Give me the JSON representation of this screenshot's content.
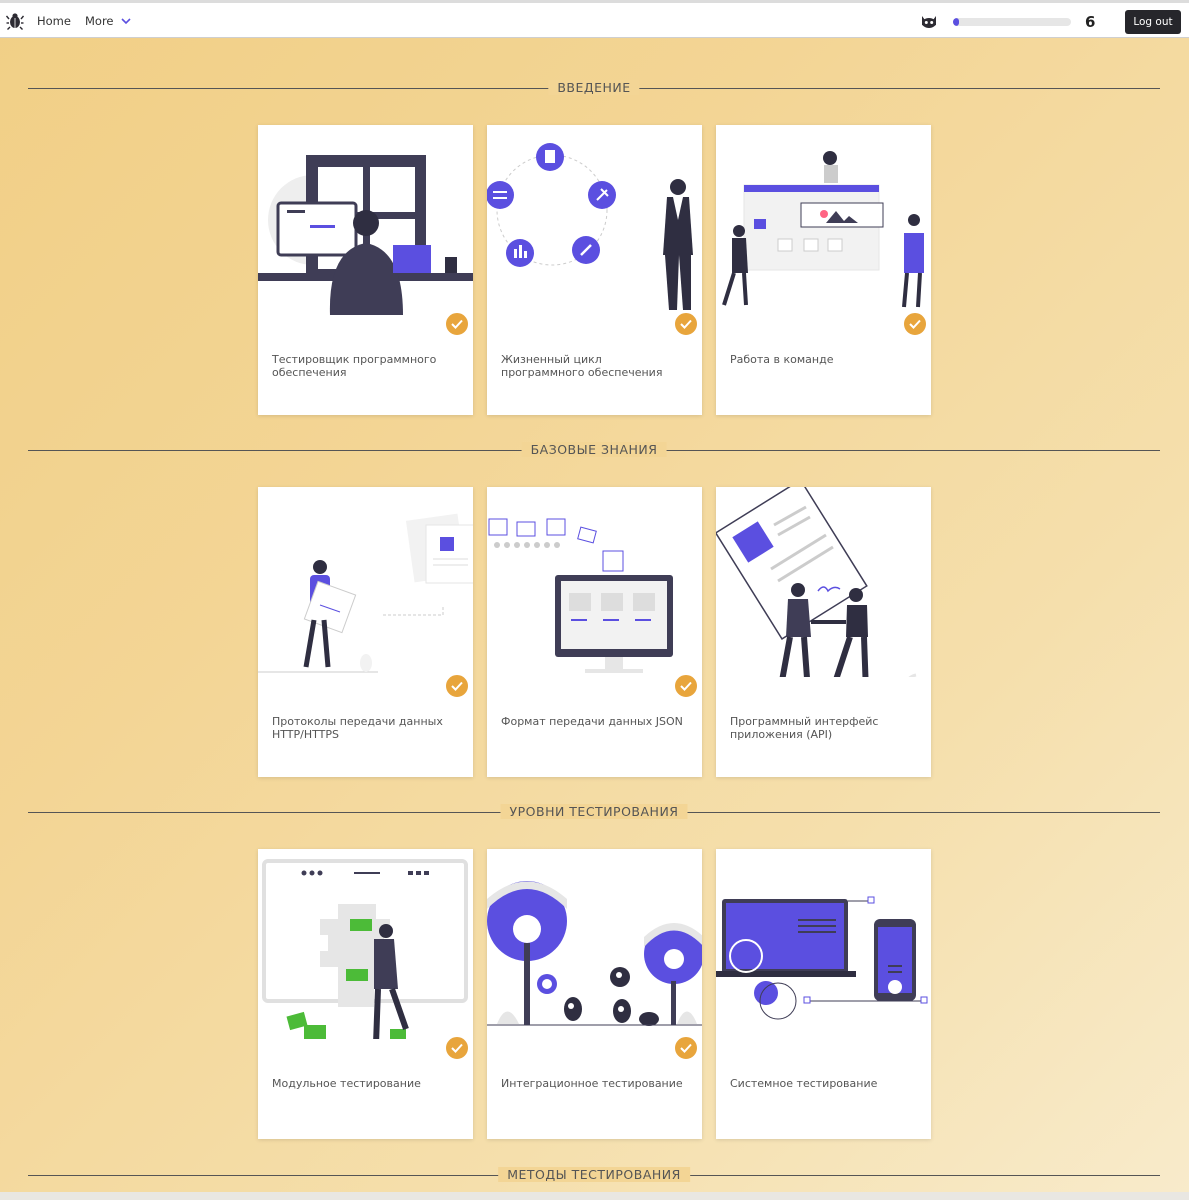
{
  "nav": {
    "home": "Home",
    "more": "More",
    "points": "6",
    "logout": "Log out",
    "progress": 0.05,
    "logo_icon": "bug-logo-icon",
    "avatar_icon": "cat-avatar-icon"
  },
  "colors": {
    "accent": "#5b4fe0",
    "check": "#e8a53c",
    "dark_button": "#26262b"
  },
  "sections": [
    {
      "title": "ВВЕДЕНИЕ",
      "cards": [
        {
          "title": "Тестировщик программного обеспечения",
          "completed": true
        },
        {
          "title": "Жизненный цикл программного обеспечения",
          "completed": true
        },
        {
          "title": "Работа в команде",
          "completed": true
        }
      ]
    },
    {
      "title": "БАЗОВЫЕ ЗНАНИЯ",
      "cards": [
        {
          "title": "Протоколы передачи данных HTTP/HTTPS",
          "completed": true
        },
        {
          "title": "Формат передачи данных JSON",
          "completed": true
        },
        {
          "title": "Программный интерфейс приложения (API)",
          "completed": false
        }
      ]
    },
    {
      "title": "УРОВНИ ТЕСТИРОВАНИЯ",
      "cards": [
        {
          "title": "Модульное тестирование",
          "completed": true
        },
        {
          "title": "Интеграционное тестирование",
          "completed": true
        },
        {
          "title": "Системное тестирование",
          "completed": false
        }
      ]
    },
    {
      "title": "МЕТОДЫ ТЕСТИРОВАНИЯ",
      "cards": []
    }
  ]
}
